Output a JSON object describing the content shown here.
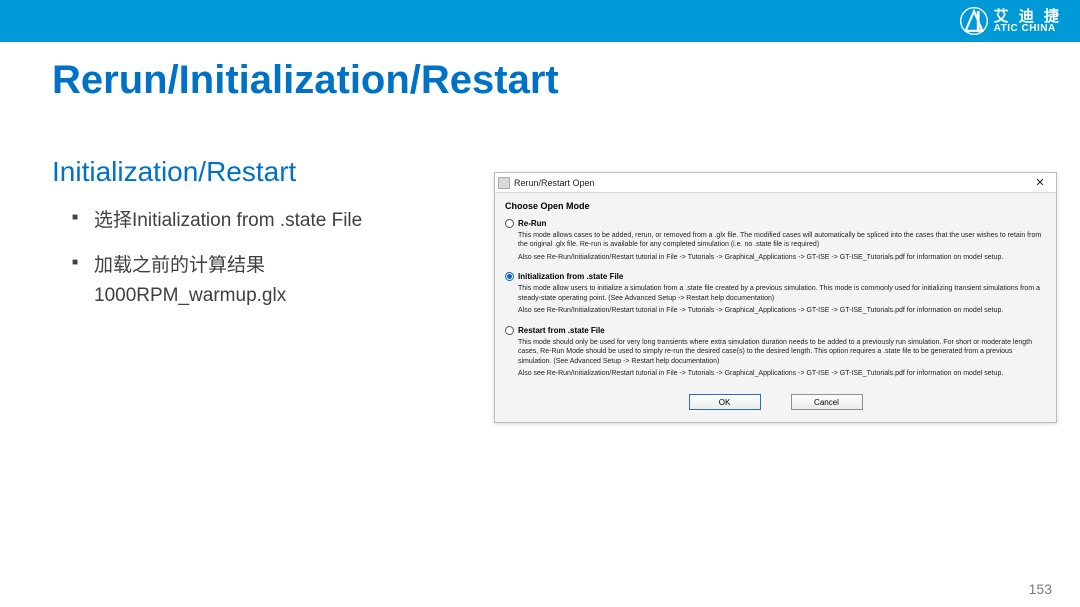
{
  "brand": {
    "cn": "艾 迪 捷",
    "en": "ATIC CHINA"
  },
  "title": "Rerun/Initialization/Restart",
  "subtitle": "Initialization/Restart",
  "bullets": [
    {
      "main": "选择Initialization from .state File",
      "sub": ""
    },
    {
      "main": "加载之前的计算结果",
      "sub": "1000RPM_warmup.glx"
    }
  ],
  "dialog": {
    "title": "Rerun/Restart Open",
    "heading": "Choose Open Mode",
    "options": [
      {
        "label": "Re-Run",
        "selected": false,
        "desc1": "This mode allows cases to be added, rerun, or removed from a .glx file. The modified cases will automatically be spliced into the cases that the user wishes to retain from the original .glx file. Re-run is available for any completed simulation (i.e. no .state file is required)",
        "desc2": "Also see Re-Run/Initialization/Restart tutorial in File -> Tutorials -> Graphical_Applications -> GT-ISE -> GT-ISE_Tutorials.pdf for information on model setup."
      },
      {
        "label": "Initialization from .state File",
        "selected": true,
        "desc1": "This mode allow users to initialize a simulation from a .state file created by a previous simulation. This mode is commonly used for initializing transient simulations from a steady-state operating point. (See Advanced Setup -> Restart help documentation)",
        "desc2": "Also see Re-Run/Initialization/Restart tutorial in File -> Tutorials -> Graphical_Applications -> GT-ISE -> GT-ISE_Tutorials.pdf for information on model setup."
      },
      {
        "label": "Restart from .state File",
        "selected": false,
        "desc1": "This mode should only be used for very long transients where extra simulation duration needs to be added to a previously run simulation. For short or moderate length cases, Re-Run Mode should be used to simply re-run the desired case(s) to the desired length. This option requires a .state file to be generated from a previous simulation. (See Advanced Setup -> Restart help documentation)",
        "desc2": "Also see Re-Run/Initialization/Restart tutorial in File -> Tutorials -> Graphical_Applications -> GT-ISE -> GT-ISE_Tutorials.pdf for information on model setup."
      }
    ],
    "buttons": {
      "ok": "OK",
      "cancel": "Cancel"
    }
  },
  "page_number": "153"
}
